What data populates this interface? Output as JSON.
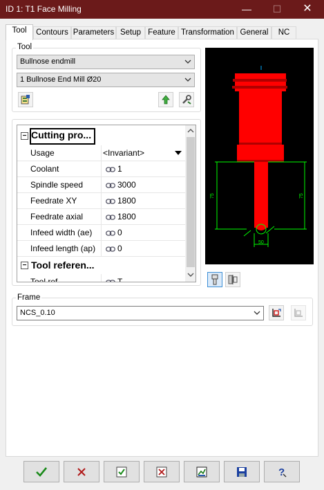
{
  "window": {
    "title": "ID 1: T1 Face Milling",
    "minimize": "—",
    "maximize": "☐",
    "close": "✕"
  },
  "tabs": [
    {
      "label": "Tool",
      "active": true
    },
    {
      "label": "Contours"
    },
    {
      "label": "Parameters"
    },
    {
      "label": "Setup"
    },
    {
      "label": "Feature"
    },
    {
      "label": "Transformation"
    },
    {
      "label": "General"
    },
    {
      "label": "NC"
    }
  ],
  "tool_group": {
    "label": "Tool",
    "type_select": "Bullnose endmill",
    "tool_select": "1  Bullnose End Mill  Ø20"
  },
  "property_grid": {
    "categories": [
      {
        "label": "Cutting pro...",
        "toggle": "−"
      },
      {
        "label": "Tool referen...",
        "toggle": "−"
      }
    ],
    "rows": [
      {
        "name": "Usage",
        "value": "<Invariant>",
        "linked": false,
        "dropdown": true
      },
      {
        "name": "Coolant",
        "value": "1",
        "linked": true
      },
      {
        "name": "Spindle speed",
        "value": "3000",
        "linked": true
      },
      {
        "name": "Feedrate XY",
        "value": "1800",
        "linked": true
      },
      {
        "name": "Feedrate axial",
        "value": "1800",
        "linked": true
      },
      {
        "name": "Infeed width (ae)",
        "value": "0",
        "linked": true
      },
      {
        "name": "Infeed length (ap)",
        "value": "0",
        "linked": true
      }
    ],
    "partial_row": {
      "name": "Tool ref",
      "value": "T"
    }
  },
  "preview": {
    "tool_color": "#ff0000",
    "dim_color": "#00ff00",
    "dim_left": "75",
    "dim_right": "75",
    "dim_bottom": "50"
  },
  "frame_group": {
    "label": "Frame",
    "value": "NCS_0.10"
  },
  "bottom_buttons": [
    "ok",
    "cancel",
    "apply",
    "discard",
    "simulate",
    "save",
    "help"
  ]
}
